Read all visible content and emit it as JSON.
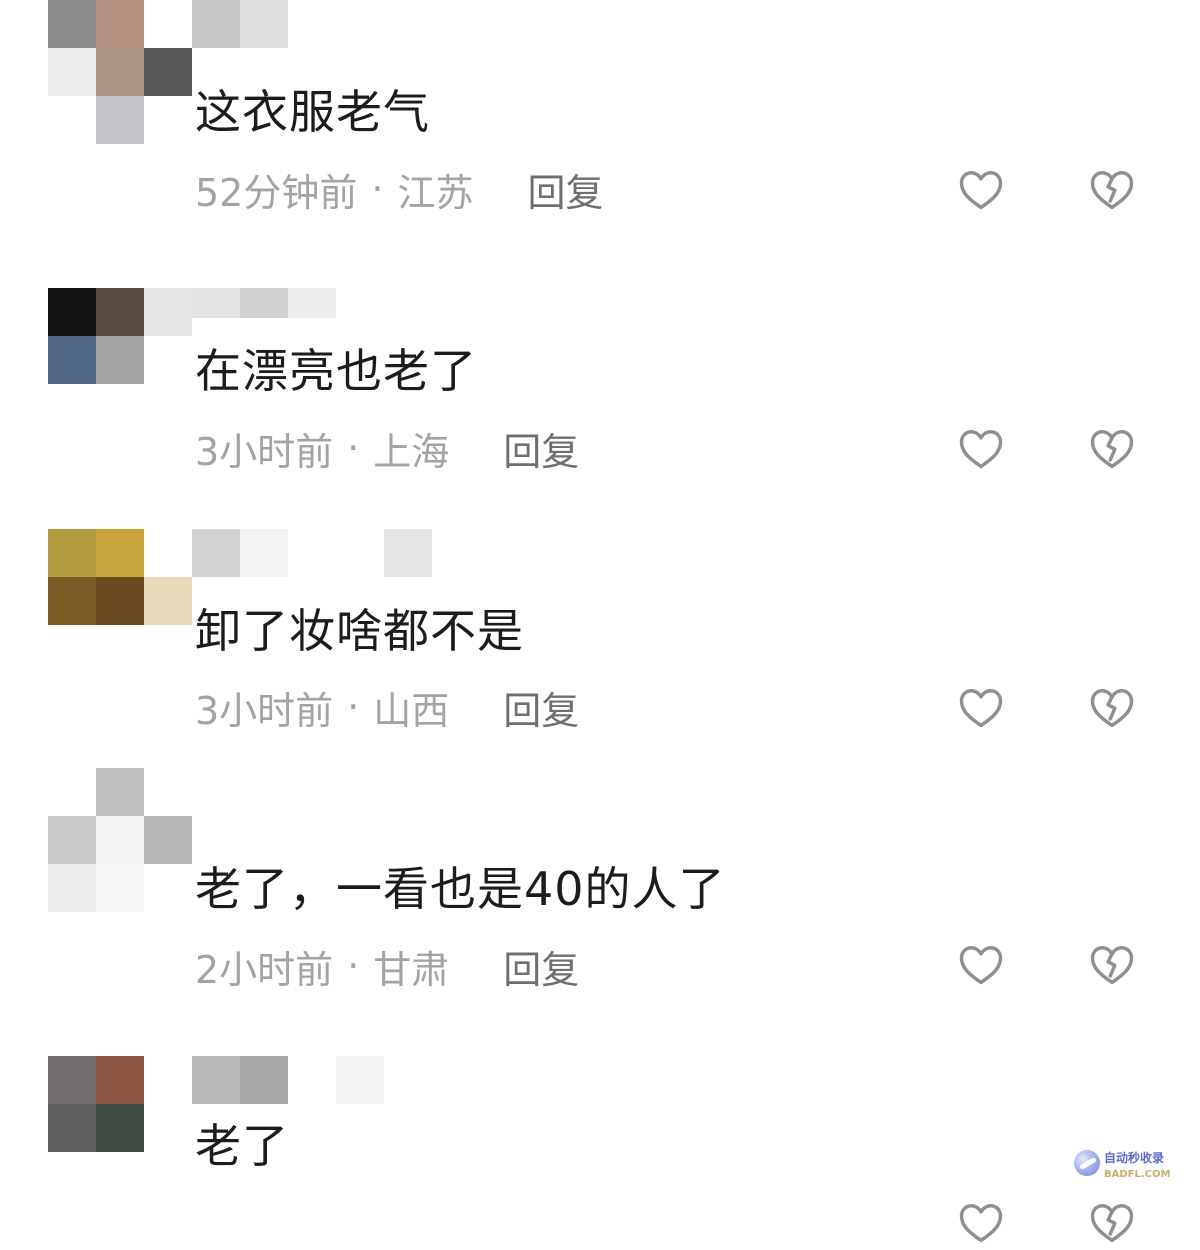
{
  "comments": [
    {
      "text": "这衣服老气",
      "time": "52分钟前",
      "location": "江苏",
      "reply": "回复",
      "avatar_colors": [
        "#8c8a8a",
        "#b49382",
        "#ffffff",
        "#f0eeee",
        "#ad9588",
        "#575757",
        "#ffffff",
        "#c3c3c8",
        "#ffffff"
      ],
      "name_colors": [
        "#c8c8ca",
        "#dedee0",
        "#ffffff",
        "#ffffff",
        "#ffffff"
      ]
    },
    {
      "text": "在漂亮也老了",
      "time": "3小时前",
      "location": "上海",
      "reply": "回复",
      "avatar_colors": [
        "#111113",
        "#5a4b40",
        "#e4e4e4",
        "#4f6783",
        "#a4a3a6",
        "#ffffff",
        "#ffffff",
        "#ffffff",
        "#ffffff"
      ],
      "name_colors": [
        "#e3e3e5",
        "#d0d0d2",
        "#eeeeee",
        "#ffffff",
        "#ffffff"
      ]
    },
    {
      "text": "卸了妆啥都不是",
      "time": "3小时前",
      "location": "山西",
      "reply": "回复",
      "avatar_colors": [
        "#b49a3e",
        "#c9a43c",
        "#ffffff",
        "#7b5a26",
        "#6a4a1e",
        "#e5d8bb",
        "#ffffff",
        "#ffffff",
        "#ffffff"
      ],
      "name_colors": [
        "#d2d2d2",
        "#f3f3f3",
        "#ffffff",
        "#ffffff",
        "#e5e5e5"
      ]
    },
    {
      "text": "老了，一看也是40的人了",
      "time": "2小时前",
      "location": "甘肃",
      "reply": "回复",
      "avatar_colors": [
        "#ffffff",
        "#c0c0c0",
        "#ffffff",
        "#c9c9c9",
        "#f2f2f2",
        "#b7b7b7",
        "#eeeeee",
        "#f7f7f7",
        "#ffffff"
      ],
      "name_colors": [
        "#ffffff",
        "#ffffff",
        "#ffffff",
        "#ffffff",
        "#ffffff"
      ]
    },
    {
      "text": "老了",
      "time": "",
      "location": "",
      "reply": "",
      "avatar_colors": [
        "#747070",
        "#8c5542",
        "#ffffff",
        "#5f5f5f",
        "#3f4a40",
        "#ffffff",
        "#ffffff",
        "#ffffff",
        "#ffffff"
      ],
      "name_colors": [
        "#b9b9b9",
        "#a9a9a9",
        "#ffffff",
        "#f2f2f2",
        "#ffffff"
      ]
    }
  ],
  "icons": {
    "like": "heart-outline-icon",
    "dislike": "broken-heart-icon"
  },
  "watermark": {
    "line1": "自动秒收录",
    "line2": "BADFL.COM"
  }
}
